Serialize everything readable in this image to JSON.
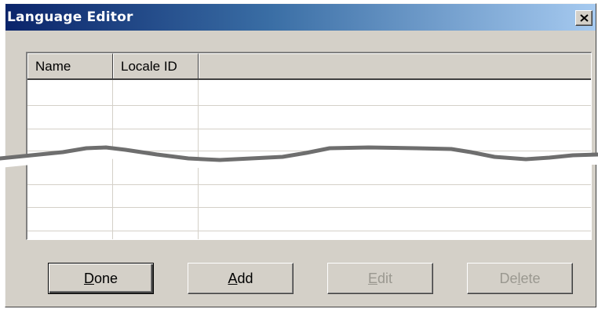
{
  "window": {
    "title": "Language Editor",
    "close_glyph": "×",
    "close_icon": "close-icon"
  },
  "table": {
    "columns": [
      "Name",
      "Locale ID",
      ""
    ],
    "rows": []
  },
  "buttons": {
    "done": {
      "accel": "D",
      "rest": "one",
      "enabled": true
    },
    "add": {
      "accel": "A",
      "rest": "dd",
      "enabled": true
    },
    "edit": {
      "accel": "E",
      "rest": "dit",
      "enabled": false
    },
    "delete": {
      "pre": "De",
      "accel": "l",
      "rest": "ete",
      "enabled": false
    }
  },
  "colors": {
    "title_gradient_start": "#0a246a",
    "title_gradient_end": "#a6caf0",
    "dialog_face": "#d4d0c8",
    "disabled_text": "#9a9890"
  }
}
